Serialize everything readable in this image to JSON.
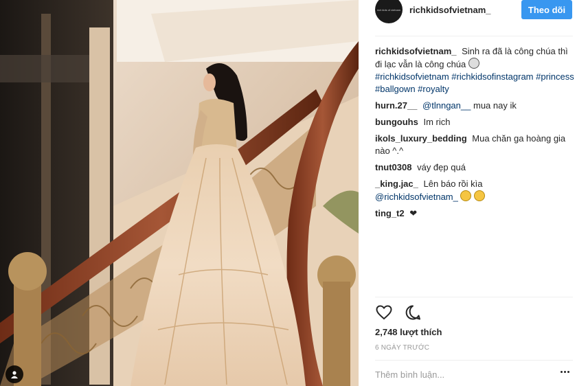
{
  "post": {
    "username": "richkidsofvietnam_",
    "avatar_text": "rich kids of vietnam",
    "follow_label": "Theo dõi",
    "icons": [
      "user-tag-icon",
      "heart-icon",
      "comment-icon",
      "more-options-icon"
    ]
  },
  "caption": {
    "user": "richkidsofvietnam_",
    "text": "Sinh ra đã là công chúa thì đi lạc vẫn là công chúa",
    "hashtags": [
      "#richkidsofvietnam",
      "#richkidsofinstagram",
      "#princess",
      "#ballgown",
      "#royalty"
    ]
  },
  "comments": [
    {
      "user": "hurn.27__",
      "mention": "@tlnngan__",
      "text": "mua nay ik"
    },
    {
      "user": "bungouhs",
      "text": "Im rich"
    },
    {
      "user": "ikols_luxury_bedding",
      "text": "Mua chăn ga hoàng gia nào ^.^"
    },
    {
      "user": "tnut0308",
      "text": "váy đẹp quá"
    },
    {
      "user": "_king.jac_",
      "text": "Lên báo rồi kìa",
      "mention": "@richkidsofvietnam_"
    },
    {
      "user": "ting_t2",
      "text": "❤"
    }
  ],
  "likes": "2,748 lượt thích",
  "time": "6 NGÀY TRƯỚC",
  "add_comment_placeholder": "Thêm bình luận..."
}
